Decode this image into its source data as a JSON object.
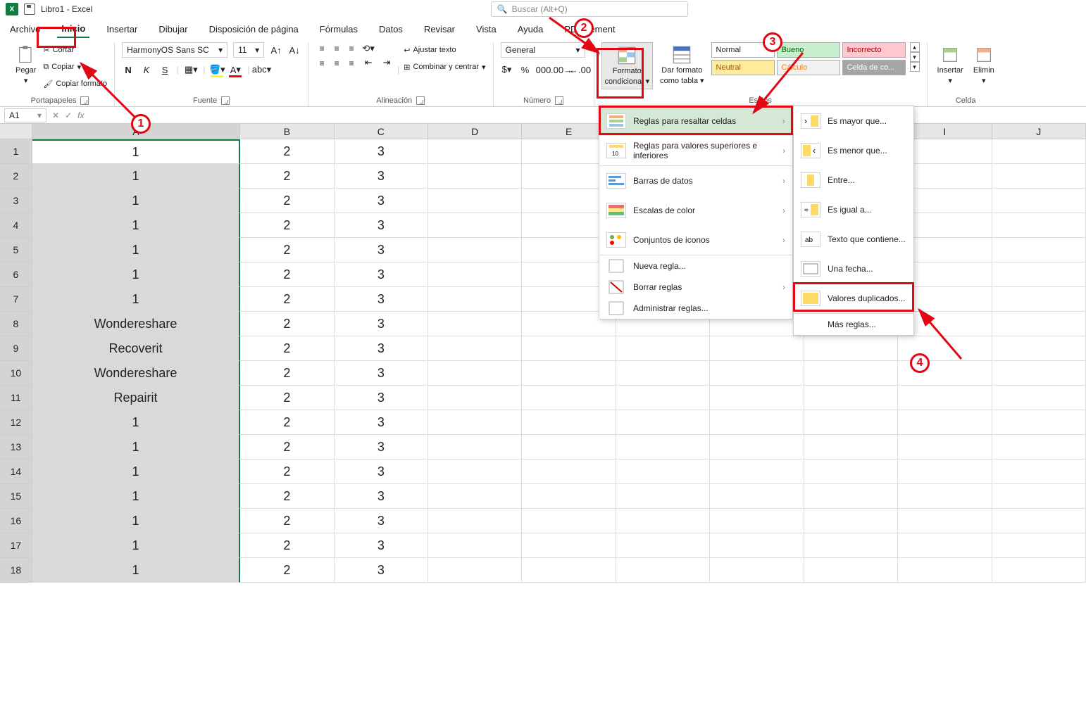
{
  "title": "Libro1 - Excel",
  "search_placeholder": "Buscar (Alt+Q)",
  "tabs": [
    "Archivo",
    "Inicio",
    "Insertar",
    "Dibujar",
    "Disposición de página",
    "Fórmulas",
    "Datos",
    "Revisar",
    "Vista",
    "Ayuda",
    "PDFelement"
  ],
  "active_tab": 1,
  "clipboard": {
    "paste": "Pegar",
    "cut": "Cortar",
    "copy": "Copiar",
    "fmt": "Copiar formato",
    "label": "Portapapeles"
  },
  "font": {
    "name": "HarmonyOS Sans SC",
    "size": "11",
    "label": "Fuente"
  },
  "alignment": {
    "wrap": "Ajustar texto",
    "merge": "Combinar y centrar",
    "label": "Alineación"
  },
  "number": {
    "format": "General",
    "label": "Número"
  },
  "cond": {
    "btn1": "Formato",
    "btn1b": "condicional",
    "btn2": "Dar formato",
    "btn2b": "como tabla"
  },
  "styles": {
    "normal": "Normal",
    "bueno": "Bueno",
    "incorrecto": "Incorrecto",
    "neutral": "Neutral",
    "calculo": "Cálculo",
    "celda": "Celda de co..."
  },
  "styles_label": "Estilos",
  "cells": {
    "insert": "Insertar",
    "delete": "Elimin",
    "label": "Celda"
  },
  "namebox": "A1",
  "columns": [
    "A",
    "B",
    "C",
    "D",
    "E",
    "F",
    "G",
    "H",
    "I",
    "J"
  ],
  "rows_data": [
    {
      "a": "1",
      "b": "2",
      "c": "3"
    },
    {
      "a": "1",
      "b": "2",
      "c": "3"
    },
    {
      "a": "1",
      "b": "2",
      "c": "3"
    },
    {
      "a": "1",
      "b": "2",
      "c": "3"
    },
    {
      "a": "1",
      "b": "2",
      "c": "3"
    },
    {
      "a": "1",
      "b": "2",
      "c": "3"
    },
    {
      "a": "1",
      "b": "2",
      "c": "3"
    },
    {
      "a": "Wondereshare",
      "b": "2",
      "c": "3"
    },
    {
      "a": "Recoverit",
      "b": "2",
      "c": "3"
    },
    {
      "a": "Wondereshare",
      "b": "2",
      "c": "3"
    },
    {
      "a": "Repairit",
      "b": "2",
      "c": "3"
    },
    {
      "a": "1",
      "b": "2",
      "c": "3"
    },
    {
      "a": "1",
      "b": "2",
      "c": "3"
    },
    {
      "a": "1",
      "b": "2",
      "c": "3"
    },
    {
      "a": "1",
      "b": "2",
      "c": "3"
    },
    {
      "a": "1",
      "b": "2",
      "c": "3"
    },
    {
      "a": "1",
      "b": "2",
      "c": "3"
    },
    {
      "a": "1",
      "b": "2",
      "c": "3"
    }
  ],
  "menu1": {
    "highlight": "Reglas para resaltar celdas",
    "top": "Reglas para valores superiores e inferiores",
    "bars": "Barras de datos",
    "scales": "Escalas de color",
    "icons": "Conjuntos de iconos",
    "new": "Nueva regla...",
    "clear": "Borrar reglas",
    "manage": "Administrar reglas..."
  },
  "menu2": {
    "gt": "Es mayor que...",
    "lt": "Es menor que...",
    "between": "Entre...",
    "eq": "Es igual a...",
    "text": "Texto que contiene...",
    "date": "Una fecha...",
    "dup": "Valores duplicados...",
    "more": "Más reglas..."
  },
  "annotations": {
    "1": "1",
    "2": "2",
    "3": "3",
    "4": "4"
  }
}
